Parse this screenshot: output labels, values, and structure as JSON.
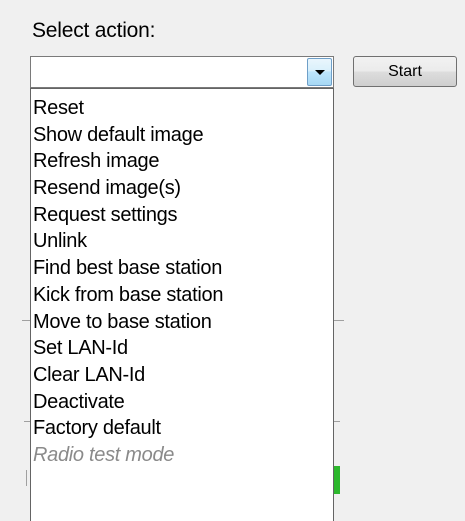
{
  "action_selector": {
    "caption": "Select action:",
    "selected_value": "",
    "start_label": "Start"
  },
  "actions": [
    {
      "label": "Reset",
      "enabled": true
    },
    {
      "label": "Show default image",
      "enabled": true
    },
    {
      "label": "Refresh image",
      "enabled": true
    },
    {
      "label": "Resend image(s)",
      "enabled": true
    },
    {
      "label": "Request settings",
      "enabled": true
    },
    {
      "label": "Unlink",
      "enabled": true
    },
    {
      "label": "Find best base station",
      "enabled": true
    },
    {
      "label": "Kick from base station",
      "enabled": true
    },
    {
      "label": "Move to base station",
      "enabled": true
    },
    {
      "label": "Set LAN-Id",
      "enabled": true
    },
    {
      "label": "Clear LAN-Id",
      "enabled": true
    },
    {
      "label": "Deactivate",
      "enabled": true
    },
    {
      "label": "Factory default",
      "enabled": true
    },
    {
      "label": "Radio test mode",
      "enabled": false
    }
  ],
  "icons": {
    "combo_button": "chevron-down-icon"
  },
  "colors": {
    "disabled_text": "#8a8a8a",
    "status_green": "#2db82d"
  }
}
